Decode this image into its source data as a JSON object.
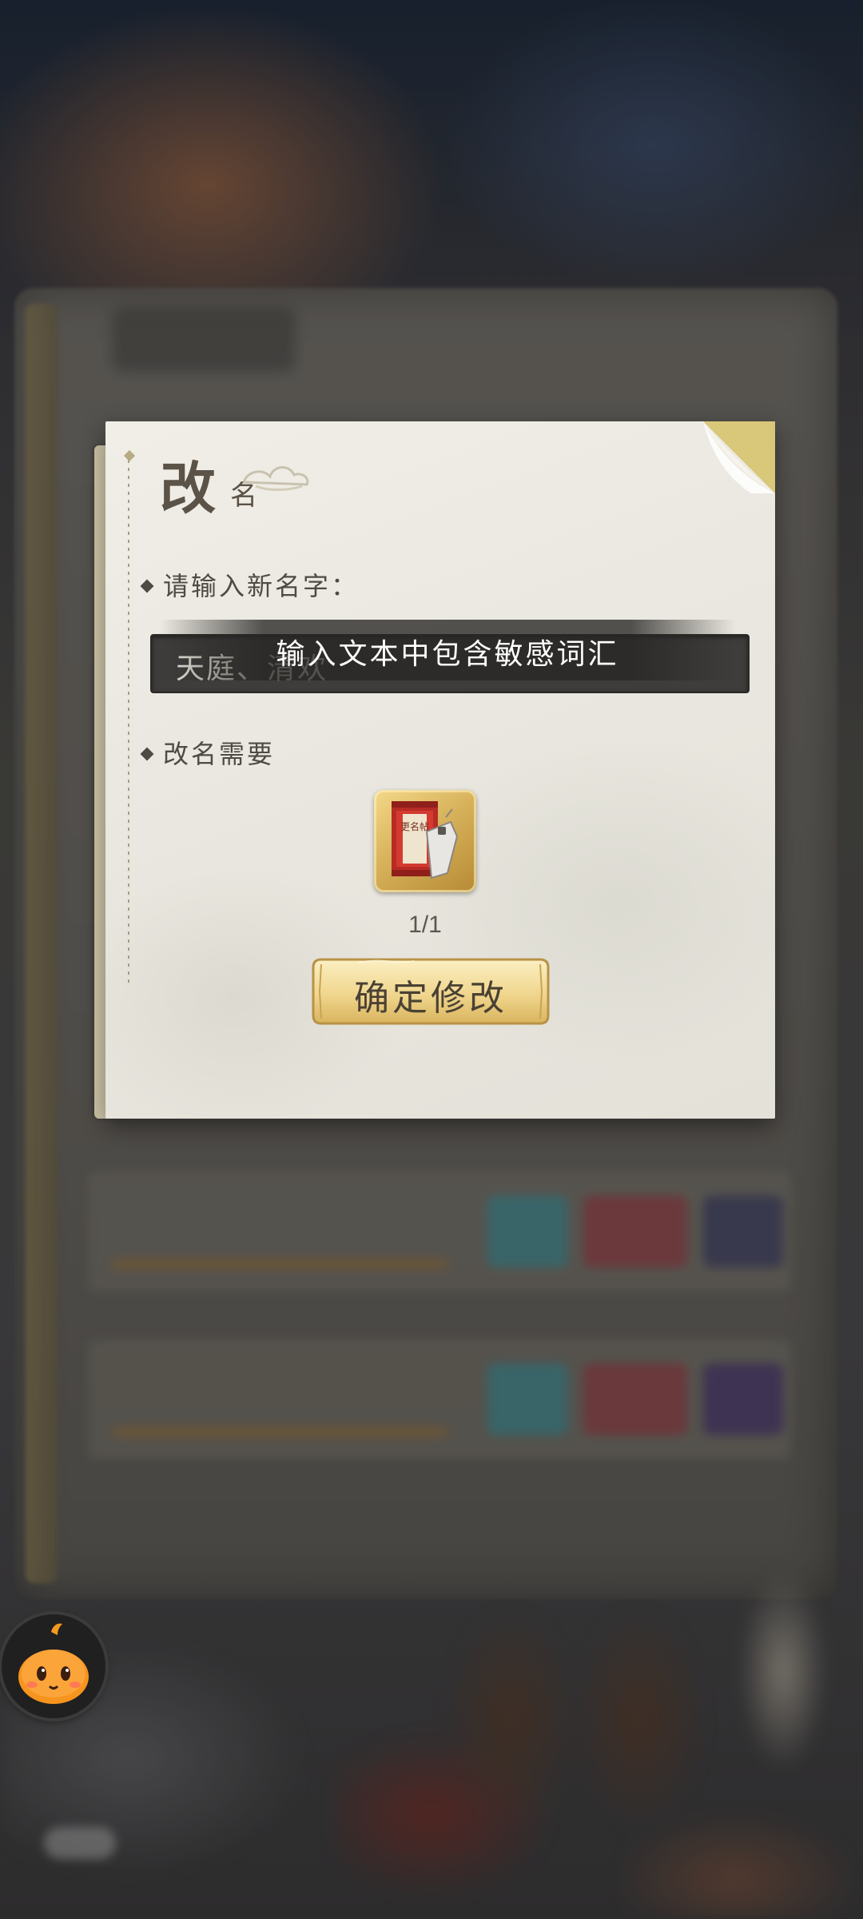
{
  "dialog": {
    "title_main": "改",
    "title_sub": "名",
    "input_label": "请输入新名字：",
    "input_value": "天庭、清欢",
    "toast_message": "输入文本中包含敏感词汇",
    "requirement_label": "改名需要",
    "item": {
      "icon": "rename-card-icon",
      "card_text": "更名帖",
      "count": "1/1"
    },
    "confirm_label": "确定修改"
  },
  "colors": {
    "paper": "#ebe9e1",
    "input_bg": "#3f3d3b",
    "button_gold": "#f1dc9c",
    "assistant_orange": "#f7941d"
  }
}
